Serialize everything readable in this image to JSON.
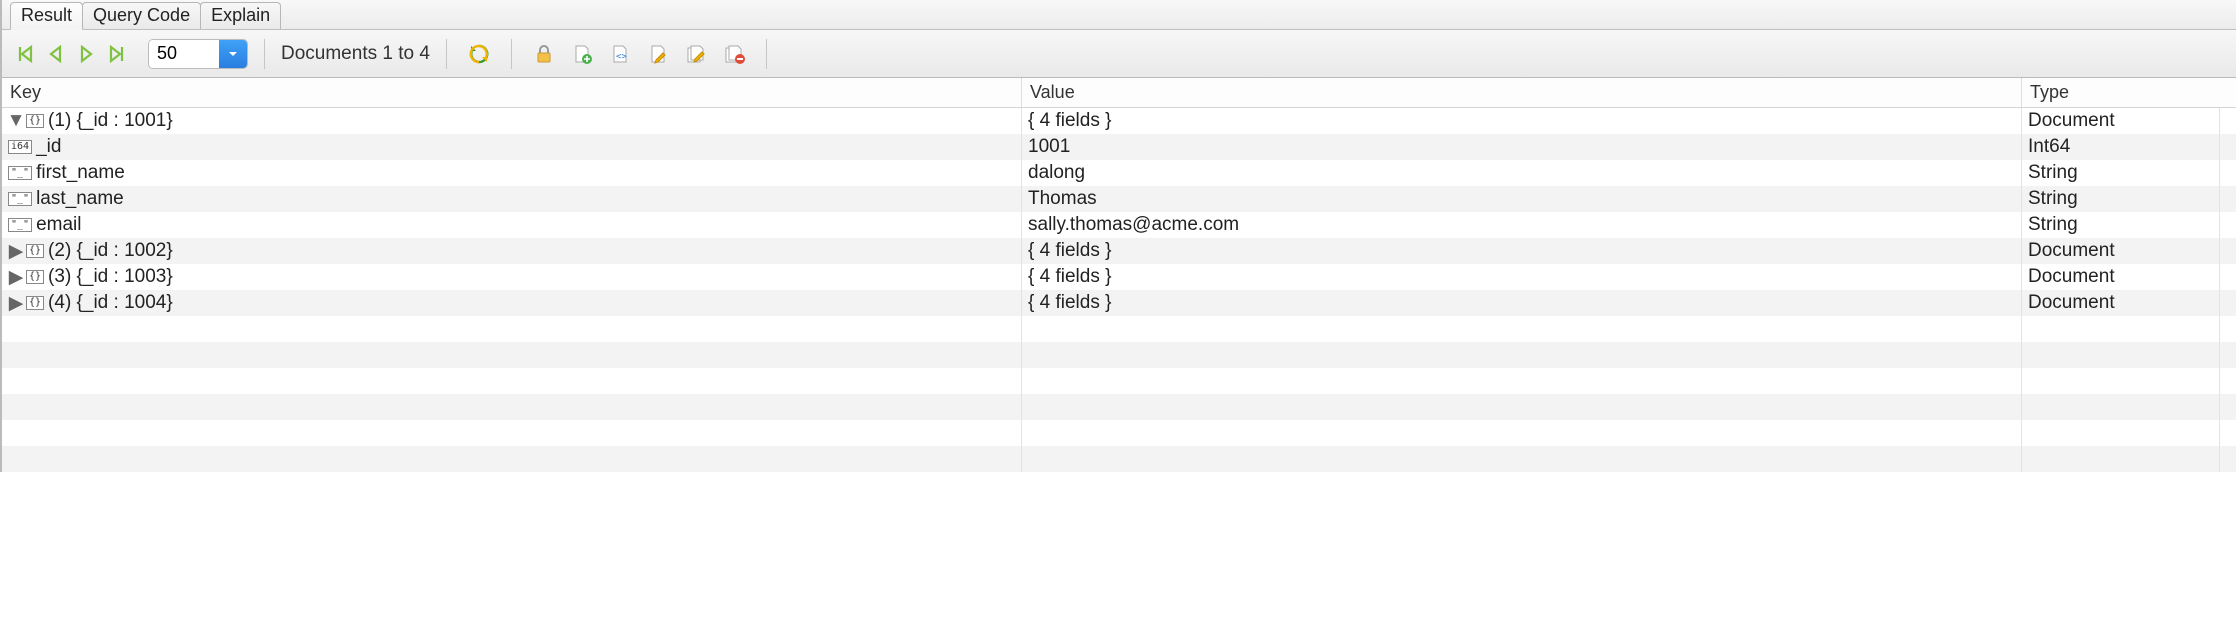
{
  "tabs": [
    {
      "label": "Result",
      "active": true
    },
    {
      "label": "Query Code",
      "active": false
    },
    {
      "label": "Explain",
      "active": false
    }
  ],
  "toolbar": {
    "page_size": "50",
    "status": "Documents 1 to 4"
  },
  "columns": {
    "key": "Key",
    "value": "Value",
    "type": "Type"
  },
  "rows": [
    {
      "indent": 0,
      "expander": "down",
      "icon": "{}",
      "key": "(1) {_id : 1001}",
      "value": "{ 4 fields }",
      "type": "Document"
    },
    {
      "indent": 1,
      "expander": "",
      "icon": "i64",
      "key": "_id",
      "value": "1001",
      "type": "Int64"
    },
    {
      "indent": 1,
      "expander": "",
      "icon": "\"_\"",
      "key": "first_name",
      "value": "dalong",
      "type": "String"
    },
    {
      "indent": 1,
      "expander": "",
      "icon": "\"_\"",
      "key": "last_name",
      "value": "Thomas",
      "type": "String"
    },
    {
      "indent": 1,
      "expander": "",
      "icon": "\"_\"",
      "key": "email",
      "value": "sally.thomas@acme.com",
      "type": "String"
    },
    {
      "indent": 0,
      "expander": "right",
      "icon": "{}",
      "key": "(2) {_id : 1002}",
      "value": "{ 4 fields }",
      "type": "Document"
    },
    {
      "indent": 0,
      "expander": "right",
      "icon": "{}",
      "key": "(3) {_id : 1003}",
      "value": "{ 4 fields }",
      "type": "Document"
    },
    {
      "indent": 0,
      "expander": "right",
      "icon": "{}",
      "key": "(4) {_id : 1004}",
      "value": "{ 4 fields }",
      "type": "Document"
    },
    {
      "indent": 0,
      "expander": "",
      "icon": "",
      "key": "",
      "value": "",
      "type": ""
    },
    {
      "indent": 0,
      "expander": "",
      "icon": "",
      "key": "",
      "value": "",
      "type": ""
    },
    {
      "indent": 0,
      "expander": "",
      "icon": "",
      "key": "",
      "value": "",
      "type": ""
    },
    {
      "indent": 0,
      "expander": "",
      "icon": "",
      "key": "",
      "value": "",
      "type": ""
    },
    {
      "indent": 0,
      "expander": "",
      "icon": "",
      "key": "",
      "value": "",
      "type": ""
    },
    {
      "indent": 0,
      "expander": "",
      "icon": "",
      "key": "",
      "value": "",
      "type": ""
    }
  ]
}
